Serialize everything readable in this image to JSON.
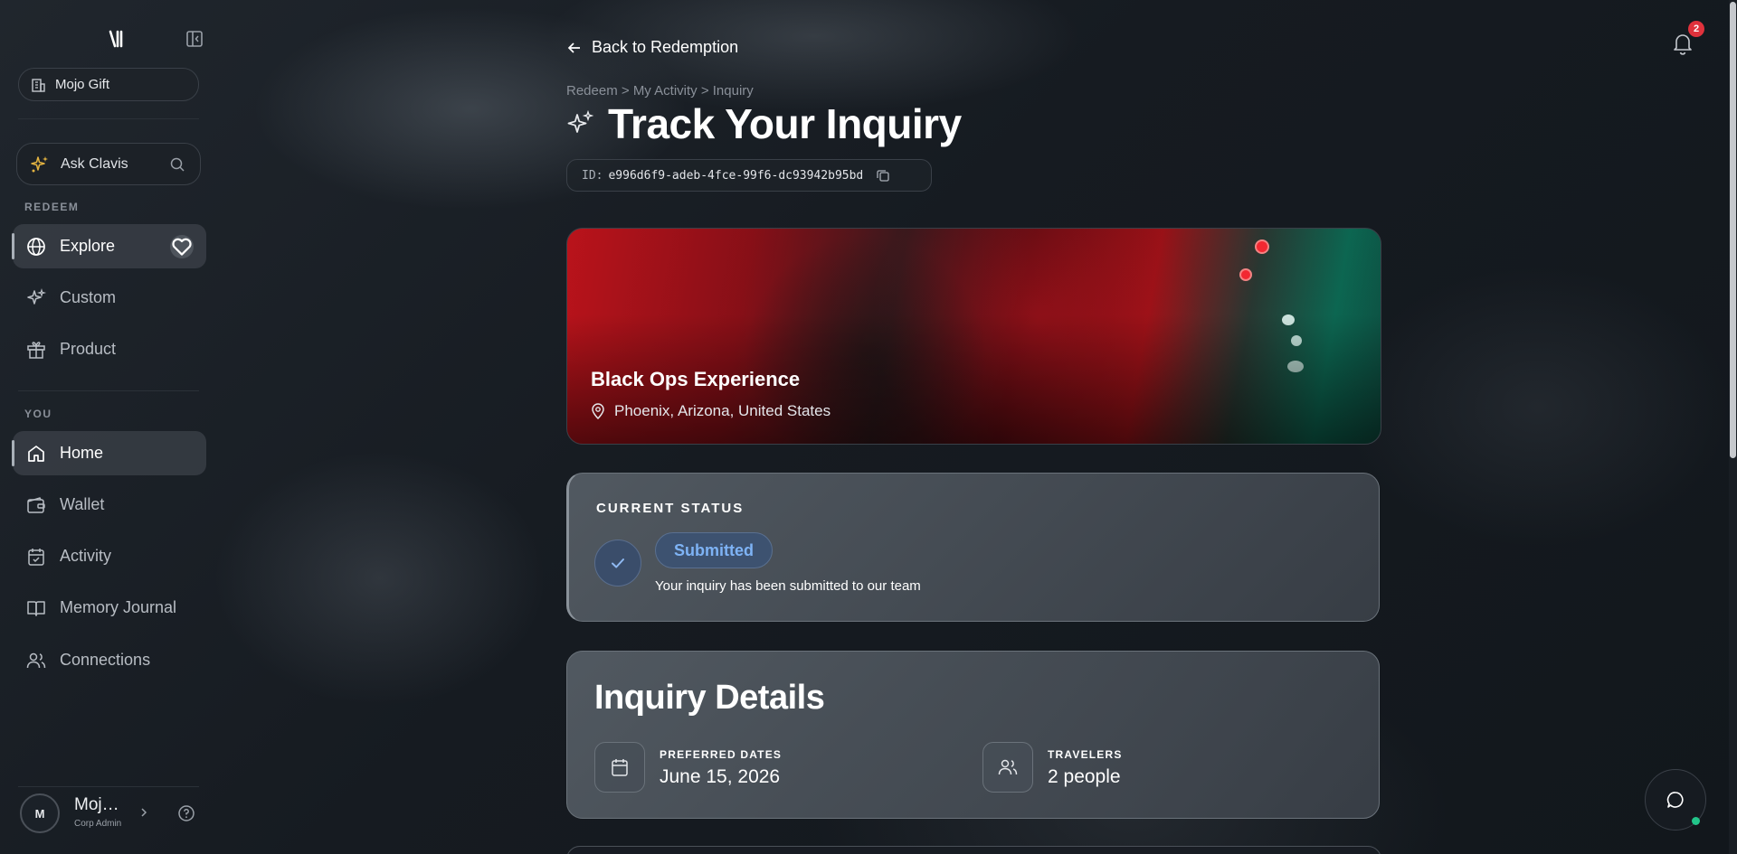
{
  "sidebar": {
    "org_name": "Mojo Gift",
    "ask_label": "Ask Clavis",
    "section_redeem": "REDEEM",
    "section_you": "YOU",
    "redeem_items": [
      {
        "label": "Explore",
        "icon": "globe-icon",
        "active": true
      },
      {
        "label": "Custom",
        "icon": "sparkles-icon"
      },
      {
        "label": "Product",
        "icon": "gift-icon"
      }
    ],
    "you_items": [
      {
        "label": "Home",
        "icon": "home-icon",
        "active": true
      },
      {
        "label": "Wallet",
        "icon": "wallet-icon"
      },
      {
        "label": "Activity",
        "icon": "calendar-check-icon"
      },
      {
        "label": "Memory Journal",
        "icon": "book-open-icon"
      },
      {
        "label": "Connections",
        "icon": "users-icon"
      }
    ],
    "user": {
      "initial": "M",
      "name": "Mojo Gift",
      "role": "Corp Admin"
    }
  },
  "header": {
    "back_label": "Back to Redemption",
    "breadcrumb": [
      "Redeem",
      "My Activity",
      "Inquiry"
    ],
    "breadcrumb_sep": ">",
    "title": "Track Your Inquiry",
    "id_label": "ID:",
    "id_value": "e996d6f9-adeb-4fce-99f6-dc93942b95bd",
    "notification_count": "2"
  },
  "experience": {
    "title": "Black Ops Experience",
    "location": "Phoenix, Arizona, United States"
  },
  "status": {
    "label": "CURRENT STATUS",
    "badge": "Submitted",
    "description": "Your inquiry has been submitted to our team",
    "badge_color": "#7eb3f5"
  },
  "details": {
    "title": "Inquiry Details",
    "dates_label": "PREFERRED DATES",
    "dates_value": "June 15, 2026",
    "travelers_label": "TRAVELERS",
    "travelers_value": "2 people"
  },
  "colors": {
    "background": "#161b21",
    "accent_blue": "#7eb3f5",
    "notification_red": "#e0323c",
    "online_green": "#22c58a"
  }
}
